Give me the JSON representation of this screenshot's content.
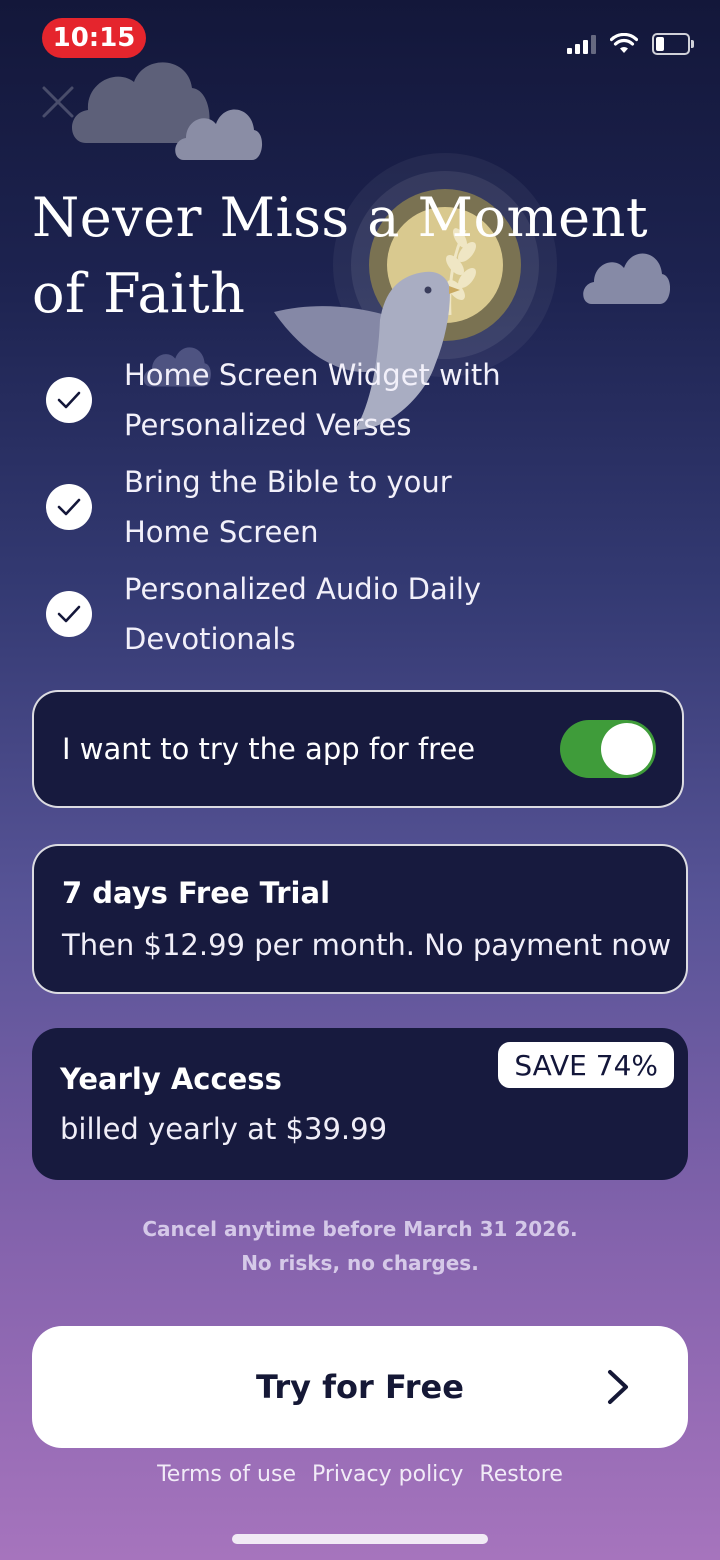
{
  "status_bar": {
    "time": "10:15",
    "icons": [
      "signal-icon",
      "wifi-icon",
      "battery-icon"
    ]
  },
  "close_icon": "close-icon",
  "headline": "Never Miss a Moment of Faith",
  "features": [
    {
      "icon": "check-icon",
      "text": "Home Screen Widget with Personalized Verses"
    },
    {
      "icon": "check-icon",
      "text": "Bring the Bible to your Home Screen"
    },
    {
      "icon": "check-icon",
      "text": "Personalized Audio Daily Devotionals"
    }
  ],
  "free_toggle": {
    "label": "I want to try the app for free",
    "on": true
  },
  "plans": [
    {
      "title": "7 days Free Trial",
      "subtitle": "Then $12.99 per month. No payment now",
      "selected": true
    },
    {
      "title": "Yearly Access",
      "subtitle": "billed yearly at $39.99",
      "badge": "SAVE 74%",
      "selected": false
    }
  ],
  "fineprint": {
    "line1": "Cancel anytime before March 31 2026.",
    "line2": "No risks, no charges."
  },
  "cta": {
    "label": "Try for Free",
    "icon": "chevron-right-icon"
  },
  "footer_links": [
    "Terms of use",
    "Privacy policy",
    "Restore"
  ],
  "colors": {
    "accent_toggle": "#3f9c3a",
    "status_time_pill": "#e5252d",
    "card_bg": "#171a3e",
    "gradient_top": "#13173a",
    "gradient_bottom": "#a674bd"
  }
}
